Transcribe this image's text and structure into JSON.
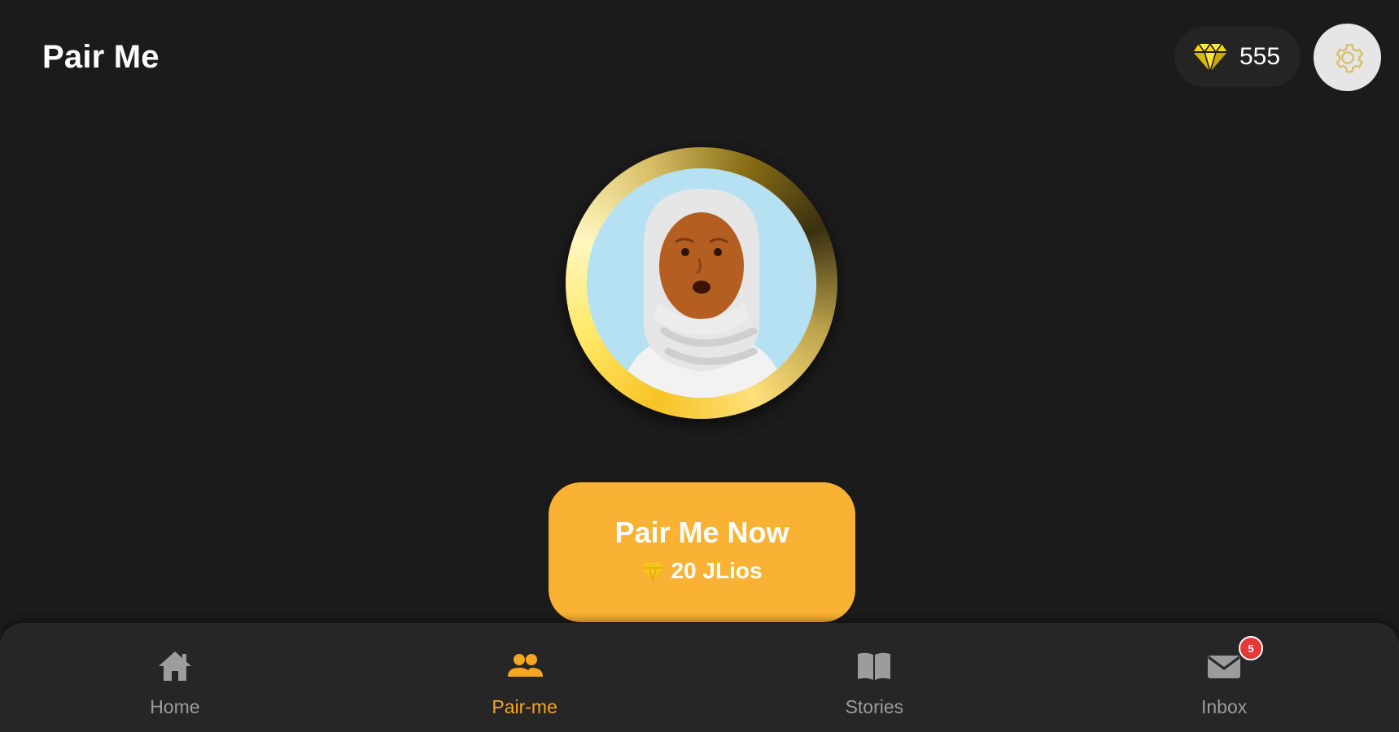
{
  "header": {
    "title": "Pair Me",
    "gems": {
      "icon": "diamond-icon",
      "count": "555",
      "color": "#f5d60a"
    },
    "settings": {
      "icon": "gear-icon"
    }
  },
  "avatar": {
    "description_icon": "avatar-woman-hijab"
  },
  "pair_button": {
    "label": "Pair Me Now",
    "cost_icon": "diamond-icon",
    "cost": "20 JLios",
    "color": "#f9b233"
  },
  "nav": {
    "items": [
      {
        "label": "Home",
        "icon": "home-icon",
        "active": false
      },
      {
        "label": "Pair-me",
        "icon": "people-icon",
        "active": true
      },
      {
        "label": "Stories",
        "icon": "book-icon",
        "active": false
      },
      {
        "label": "Inbox",
        "icon": "mail-icon",
        "active": false,
        "badge": "5"
      }
    ],
    "active_color": "#f6a623",
    "inactive_color": "#9c9c9c"
  }
}
